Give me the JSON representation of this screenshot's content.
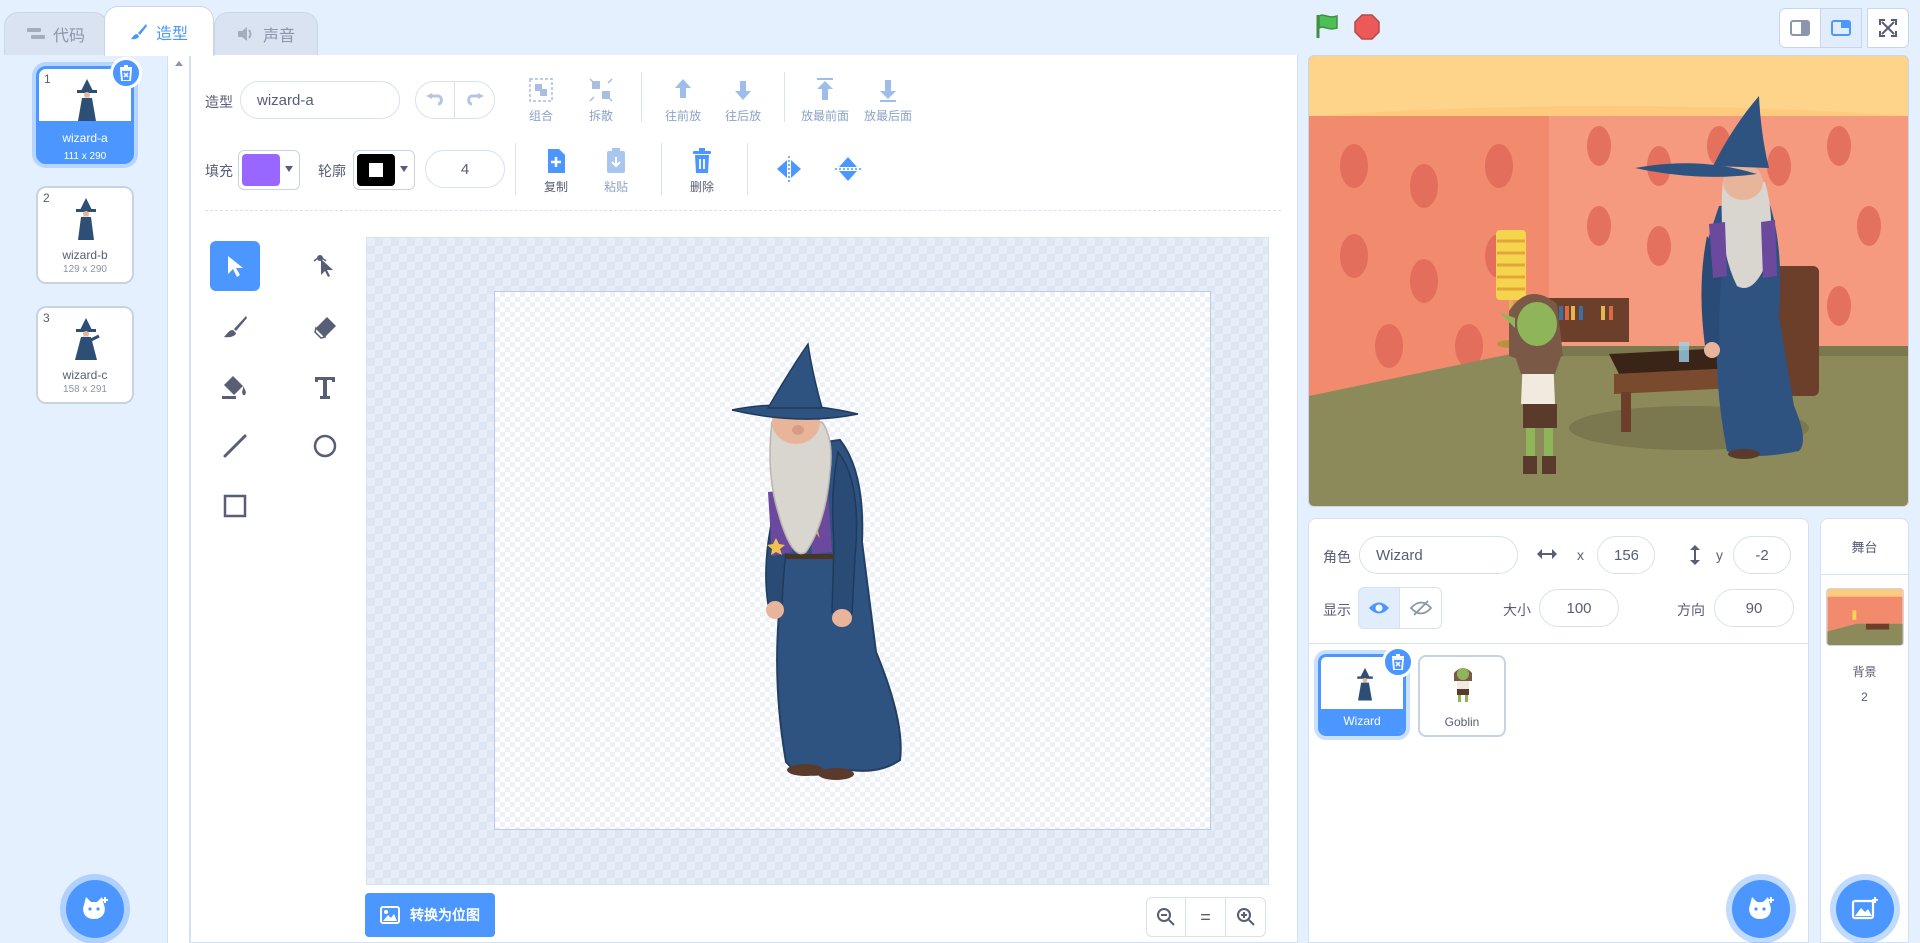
{
  "tabs": [
    {
      "label": "代码",
      "icon": "code-icon"
    },
    {
      "label": "造型",
      "icon": "brush-icon"
    },
    {
      "label": "声音",
      "icon": "speaker-icon"
    }
  ],
  "costumes": [
    {
      "number": "1",
      "name": "wizard-a",
      "size": "111 x 290"
    },
    {
      "number": "2",
      "name": "wizard-b",
      "size": "129 x 290"
    },
    {
      "number": "3",
      "name": "wizard-c",
      "size": "158 x 291"
    }
  ],
  "editor": {
    "costume_label": "造型",
    "costume_name": "wizard-a",
    "group_label": "组合",
    "ungroup_label": "拆散",
    "forward_label": "往前放",
    "backward_label": "往后放",
    "front_label": "放最前面",
    "back_label": "放最后面",
    "fill_label": "填充",
    "fill_color": "#9966ff",
    "outline_label": "轮廓",
    "outline_color": "#000000",
    "outline_width": "4",
    "copy_label": "复制",
    "paste_label": "粘贴",
    "delete_label": "删除",
    "convert_label": "转换为位图",
    "zoom_reset_label": "="
  },
  "sprite": {
    "sprite_label": "角色",
    "name": "Wizard",
    "x_label": "x",
    "x": "156",
    "y_label": "y",
    "y": "-2",
    "show_label": "显示",
    "size_label": "大小",
    "size": "100",
    "direction_label": "方向",
    "direction": "90"
  },
  "sprites": [
    {
      "name": "Wizard"
    },
    {
      "name": "Goblin"
    }
  ],
  "stage": {
    "header": "舞台",
    "backdrop_label": "背景",
    "backdrop_count": "2"
  },
  "colors": {
    "accent": "#4c97ff",
    "go": "#4cbf56",
    "stop": "#ec5959"
  }
}
